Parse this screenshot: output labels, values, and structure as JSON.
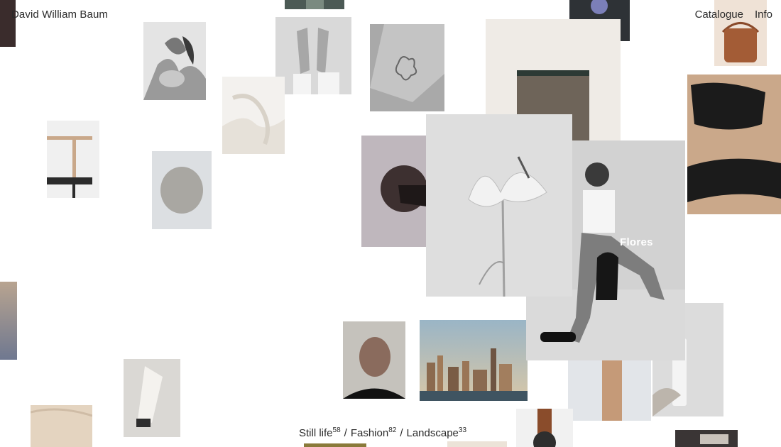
{
  "site": {
    "name": "David William Baum"
  },
  "nav": {
    "catalogue": "Catalogue",
    "info": "Info"
  },
  "featured": {
    "label": "Flores"
  },
  "categories": [
    {
      "label": "Still life",
      "count": "58"
    },
    {
      "label": "Fashion",
      "count": "82"
    },
    {
      "label": "Landscape",
      "count": "33"
    }
  ],
  "separator": "/",
  "colors": {
    "background": "#ffffff",
    "text": "#2a2a2a",
    "featured_label": "#ffffff"
  }
}
